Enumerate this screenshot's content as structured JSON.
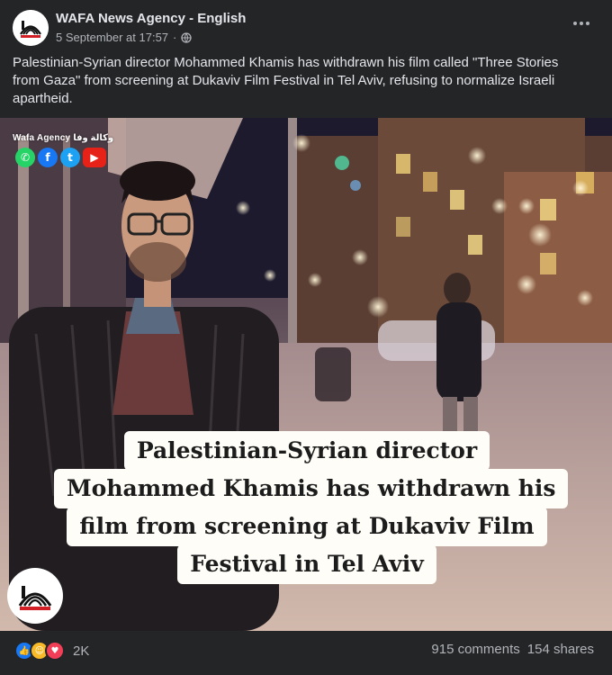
{
  "post": {
    "page_name": "WAFA News Agency - English",
    "timestamp": "5 September at 17:57",
    "separator": "·",
    "privacy_icon": "globe-icon",
    "more_icon": "more-options-icon",
    "caption": "Palestinian-Syrian director Mohammed Khamis has withdrawn his film called \"Three Stories from Gaza\" from screening at Dukaviv Film Festival in Tel Aviv, refusing to normalize Israeli apartheid."
  },
  "image": {
    "watermark": "Wafa Agency وكالة وفا",
    "social_icons": [
      "whatsapp-icon",
      "facebook-icon",
      "twitter-icon",
      "youtube-icon"
    ],
    "headline_lines": [
      "Palestinian-Syrian director",
      "Mohammed Khamis has withdrawn his",
      "film from screening at Dukaviv Film",
      "Festival in Tel Aviv"
    ]
  },
  "footer": {
    "reactions": [
      "like-icon",
      "haha-icon",
      "love-icon"
    ],
    "reaction_count": "2K",
    "comments": "915 comments",
    "shares": "154 shares"
  },
  "colors": {
    "background": "#242526",
    "text_primary": "#e4e6eb",
    "text_secondary": "#b0b3b8",
    "like_blue": "#1877f2",
    "love_red": "#f33e58",
    "haha_yellow": "#f7b928"
  }
}
